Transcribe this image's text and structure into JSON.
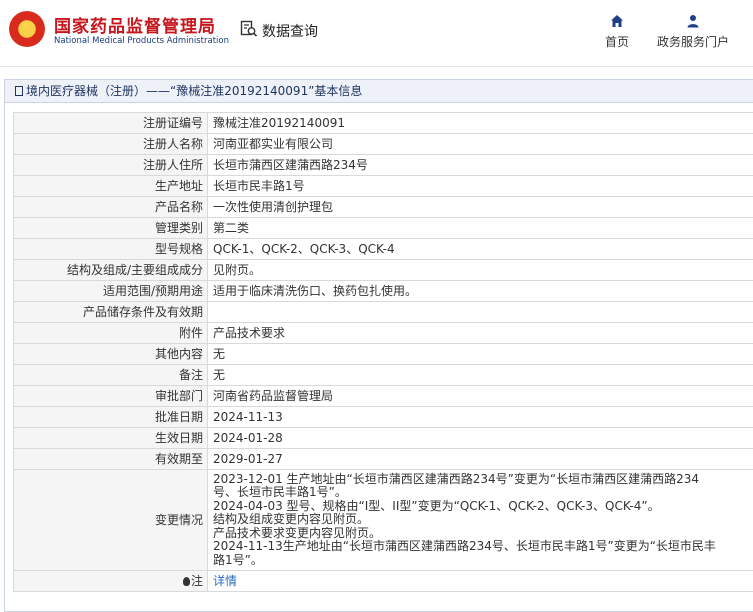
{
  "header": {
    "brand_cn": "国家药品监督管理局",
    "brand_en": "National Medical Products Administration",
    "search_label": "数据查询",
    "nav": [
      {
        "label": "首页",
        "icon": "home-icon"
      },
      {
        "label": "政务服务门户",
        "icon": "user-icon"
      }
    ]
  },
  "panel": {
    "title": "境内医疗器械（注册）——“豫械注准20192140091”基本信息"
  },
  "rows": [
    {
      "label": "注册证编号",
      "value": "豫械注准20192140091"
    },
    {
      "label": "注册人名称",
      "value": "河南亚都实业有限公司"
    },
    {
      "label": "注册人住所",
      "value": "长垣市蒲西区建蒲西路234号"
    },
    {
      "label": "生产地址",
      "value": "长垣市民丰路1号"
    },
    {
      "label": "产品名称",
      "value": "一次性使用清创护理包"
    },
    {
      "label": "管理类别",
      "value": "第二类"
    },
    {
      "label": "型号规格",
      "value": "QCK-1、QCK-2、QCK-3、QCK-4"
    },
    {
      "label": "结构及组成/主要组成成分",
      "value": "见附页。"
    },
    {
      "label": "适用范围/预期用途",
      "value": "适用于临床清洗伤口、换药包扎使用。"
    },
    {
      "label": "产品储存条件及有效期",
      "value": ""
    },
    {
      "label": "附件",
      "value": "产品技术要求"
    },
    {
      "label": "其他内容",
      "value": "无"
    },
    {
      "label": "备注",
      "value": "无"
    },
    {
      "label": "审批部门",
      "value": "河南省药品监督管理局"
    },
    {
      "label": "批准日期",
      "value": "2024-11-13"
    },
    {
      "label": "生效日期",
      "value": "2024-01-28"
    },
    {
      "label": "有效期至",
      "value": "2029-01-27"
    }
  ],
  "change": {
    "label": "变更情况",
    "lines": [
      "2023-12-01 生产地址由“长垣市蒲西区建蒲西路234号”变更为“长垣市蒲西区建蒲西路234",
      "号、长垣市民丰路1号”。",
      "2024-04-03 型号、规格由“I型、II型”变更为“QCK-1、QCK-2、QCK-3、QCK-4”。",
      "结构及组成变更内容见附页。",
      "产品技术要求变更内容见附页。",
      "2024-11-13生产地址由“长垣市蒲西区建蒲西路234号、长垣市民丰路1号”变更为“长垣市民丰",
      "路1号”。"
    ]
  },
  "note": {
    "label": "注",
    "link": "详情"
  }
}
